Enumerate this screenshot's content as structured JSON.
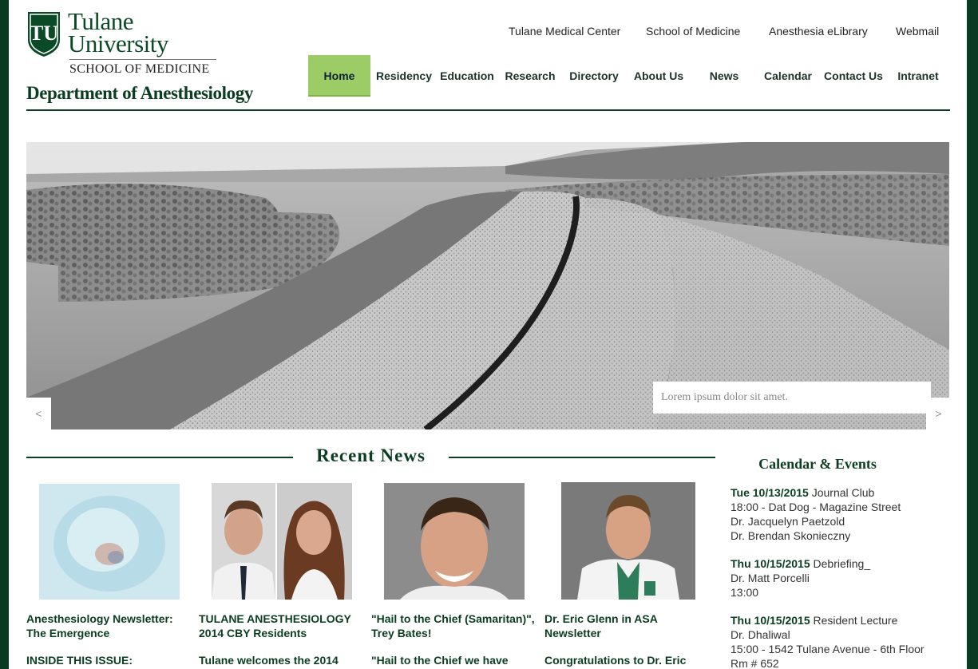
{
  "brand": {
    "line1": "Tulane",
    "line2": "University",
    "school": "SCHOOL OF MEDICINE",
    "department": "Department of Anesthesiology"
  },
  "utility_links": [
    "Tulane Medical Center",
    "School of Medicine",
    "Anesthesia eLibrary",
    "Webmail"
  ],
  "nav": [
    "Home",
    "Residency",
    "Education",
    "Research",
    "Directory",
    "About Us",
    "News",
    "Calendar",
    "Contact Us",
    "Intranet"
  ],
  "nav_active": "Home",
  "hero": {
    "caption": "Lorem ipsum dolor sit amet.",
    "prev": "<",
    "next": ">"
  },
  "recent_news": {
    "title": "Recent News",
    "items": [
      {
        "headline": "Anesthesiology Newsletter: The Emergence",
        "teaser": "INSIDE THIS ISSUE:"
      },
      {
        "headline": "TULANE ANESTHESIOLOGY 2014 CBY Residents",
        "teaser": "Tulane welcomes the 2014"
      },
      {
        "headline": "\"Hail to the Chief (Samaritan)\", Trey Bates!",
        "teaser": "\"Hail to the Chief we have"
      },
      {
        "headline": "Dr. Eric Glenn in ASA Newsletter",
        "teaser": "Congratulations to Dr. Eric"
      }
    ]
  },
  "calendar": {
    "title": "Calendar & Events",
    "events": [
      {
        "date": "Tue 10/13/2015",
        "name": "Journal Club",
        "details": [
          "18:00 - Dat Dog - Magazine Street",
          "Dr. Jacquelyn Paetzold",
          "Dr. Brendan Skonieczny"
        ]
      },
      {
        "date": "Thu 10/15/2015",
        "name": "Debriefing_",
        "details": [
          "Dr. Matt Porcelli",
          "13:00"
        ]
      },
      {
        "date": "Thu 10/15/2015",
        "name": "Resident Lecture",
        "details": [
          "Dr. Dhaliwal",
          "15:00 - 1542 Tulane Avenue - 6th Floor",
          "Rm # 652"
        ]
      }
    ]
  },
  "colors": {
    "brand_green": "#0b3d22",
    "nav_active": "#9ccc66",
    "frame": "#0a3a22"
  }
}
